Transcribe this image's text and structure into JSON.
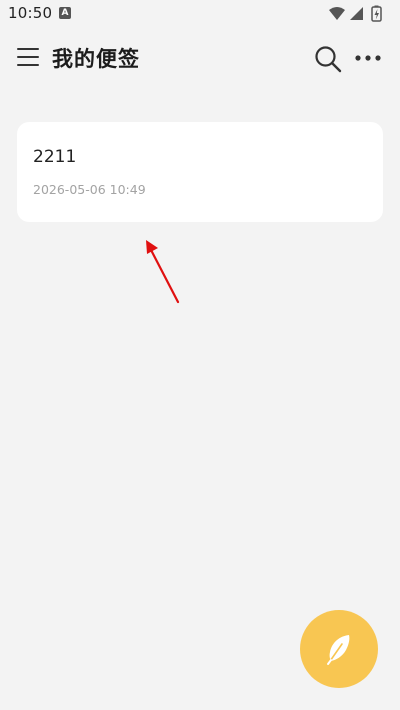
{
  "status_bar": {
    "time": "10:50",
    "notification_icon": "a-badge-icon",
    "wifi_icon": "wifi-icon",
    "signal_icon": "signal-icon",
    "battery_icon": "battery-charging-icon"
  },
  "header": {
    "title": "我的便签",
    "menu_icon": "hamburger-menu-icon",
    "search_icon": "search-icon",
    "more_icon": "more-dots-icon"
  },
  "notes": [
    {
      "title": "2211",
      "timestamp": "2026-05-06 10:49"
    }
  ],
  "fab": {
    "icon": "feather-icon",
    "color": "#f8c652"
  },
  "colors": {
    "background": "#f3f3f3",
    "card": "#ffffff",
    "accent": "#f8c652",
    "annotation_arrow": "#e01010"
  }
}
